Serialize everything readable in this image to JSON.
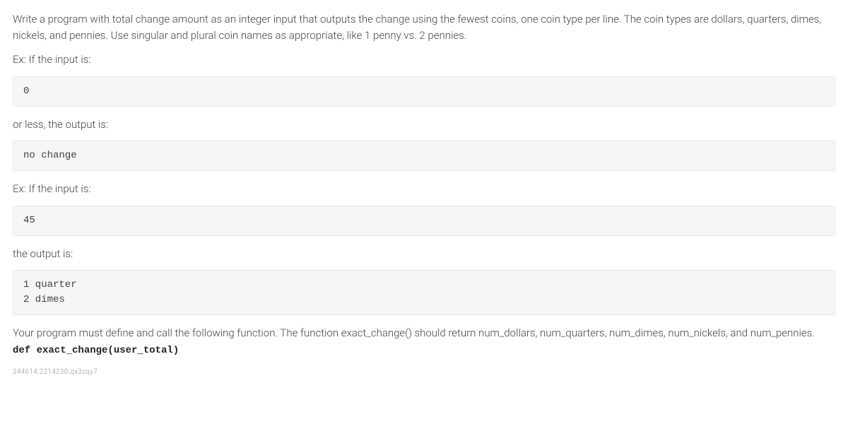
{
  "intro": "Write a program with total change amount as an integer input that outputs the change using the fewest coins, one coin type per line. The coin types are dollars, quarters, dimes, nickels, and pennies. Use singular and plural coin names as appropriate, like 1 penny vs. 2 pennies.",
  "ex1_label": "Ex: If the input is:",
  "code1": "0",
  "or_less": "or less, the output is:",
  "code2": "no change",
  "ex2_label": "Ex: If the input is:",
  "code3": "45",
  "output_label": "the output is:",
  "code4": "1 quarter\n2 dimes",
  "func_desc": "Your program must define and call the following function. The function exact_change() should return num_dollars, num_quarters, num_dimes, num_nickels, and num_pennies.",
  "func_sig": "def exact_change(user_total)",
  "footer": "344614.2214230.qx3zqy7"
}
